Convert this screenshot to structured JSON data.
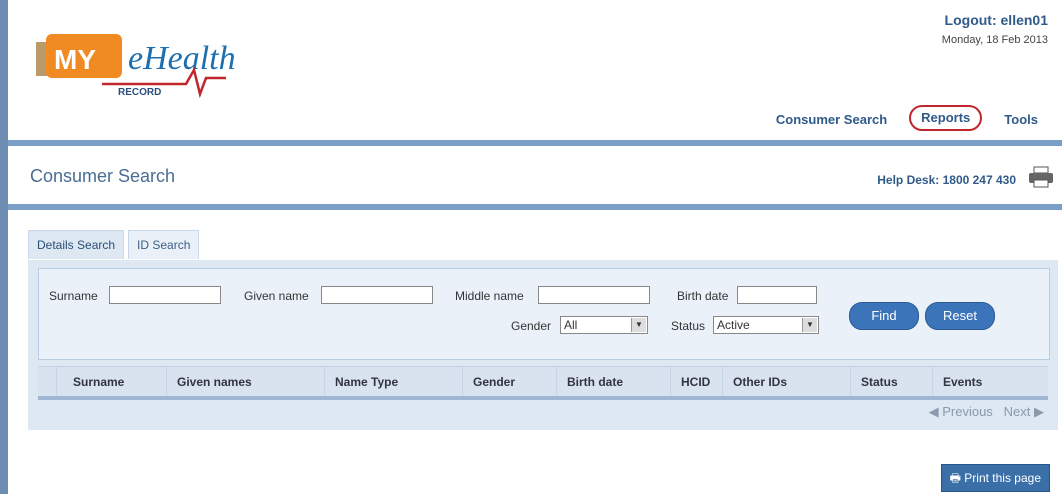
{
  "header": {
    "logo": {
      "my": "MY",
      "ehealth": "eHealth",
      "record": "RECORD"
    },
    "logout": "Logout: ellen01",
    "date": "Monday, 18 Feb 2013",
    "nav": [
      {
        "label": "Consumer Search"
      },
      {
        "label": "Reports"
      },
      {
        "label": "Tools"
      }
    ]
  },
  "titlebar": {
    "title": "Consumer Search",
    "helpdesk": "Help Desk: 1800 247 430"
  },
  "tabs": [
    {
      "label": "Details Search",
      "active": true
    },
    {
      "label": "ID Search",
      "active": false
    }
  ],
  "search": {
    "surname_label": "Surname",
    "given_label": "Given name",
    "middle_label": "Middle name",
    "birth_label": "Birth date",
    "gender_label": "Gender",
    "gender_value": "All",
    "status_label": "Status",
    "status_value": "Active",
    "find": "Find",
    "reset": "Reset"
  },
  "grid": {
    "columns": [
      "Surname",
      "Given names",
      "Name Type",
      "Gender",
      "Birth date",
      "HCID",
      "Other IDs",
      "Status",
      "Events"
    ]
  },
  "pager": {
    "previous": "Previous",
    "next": "Next"
  },
  "print": "Print this page",
  "colors": {
    "accent": "#3b74b8",
    "band": "#7aa0c8",
    "highlight": "#c0272d"
  }
}
